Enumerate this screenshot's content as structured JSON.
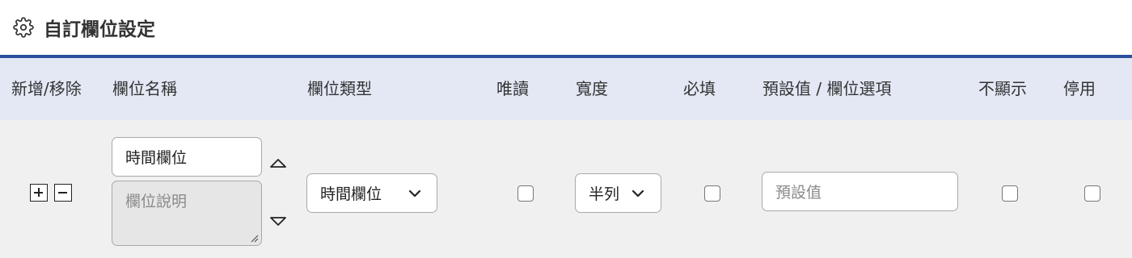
{
  "header": {
    "icon": "gear-icon",
    "title": "自訂欄位設定"
  },
  "colors": {
    "accent_bar": "#2a4f9e",
    "header_bg": "#e3e8f4",
    "row_bg": "#f0f0f0"
  },
  "columns": {
    "add_remove": "新增/移除",
    "field_name": "欄位名稱",
    "field_type": "欄位類型",
    "readonly": "唯讀",
    "width": "寬度",
    "required": "必填",
    "default_options": "預設值 / 欄位選項",
    "hidden": "不顯示",
    "disabled": "停用"
  },
  "row": {
    "name_value": "時間欄位",
    "description_placeholder": "欄位說明",
    "type_selected": "時間欄位",
    "width_selected": "半列",
    "default_placeholder": "預設值",
    "readonly_checked": false,
    "required_checked": false,
    "hidden_checked": false,
    "disabled_checked": false
  }
}
